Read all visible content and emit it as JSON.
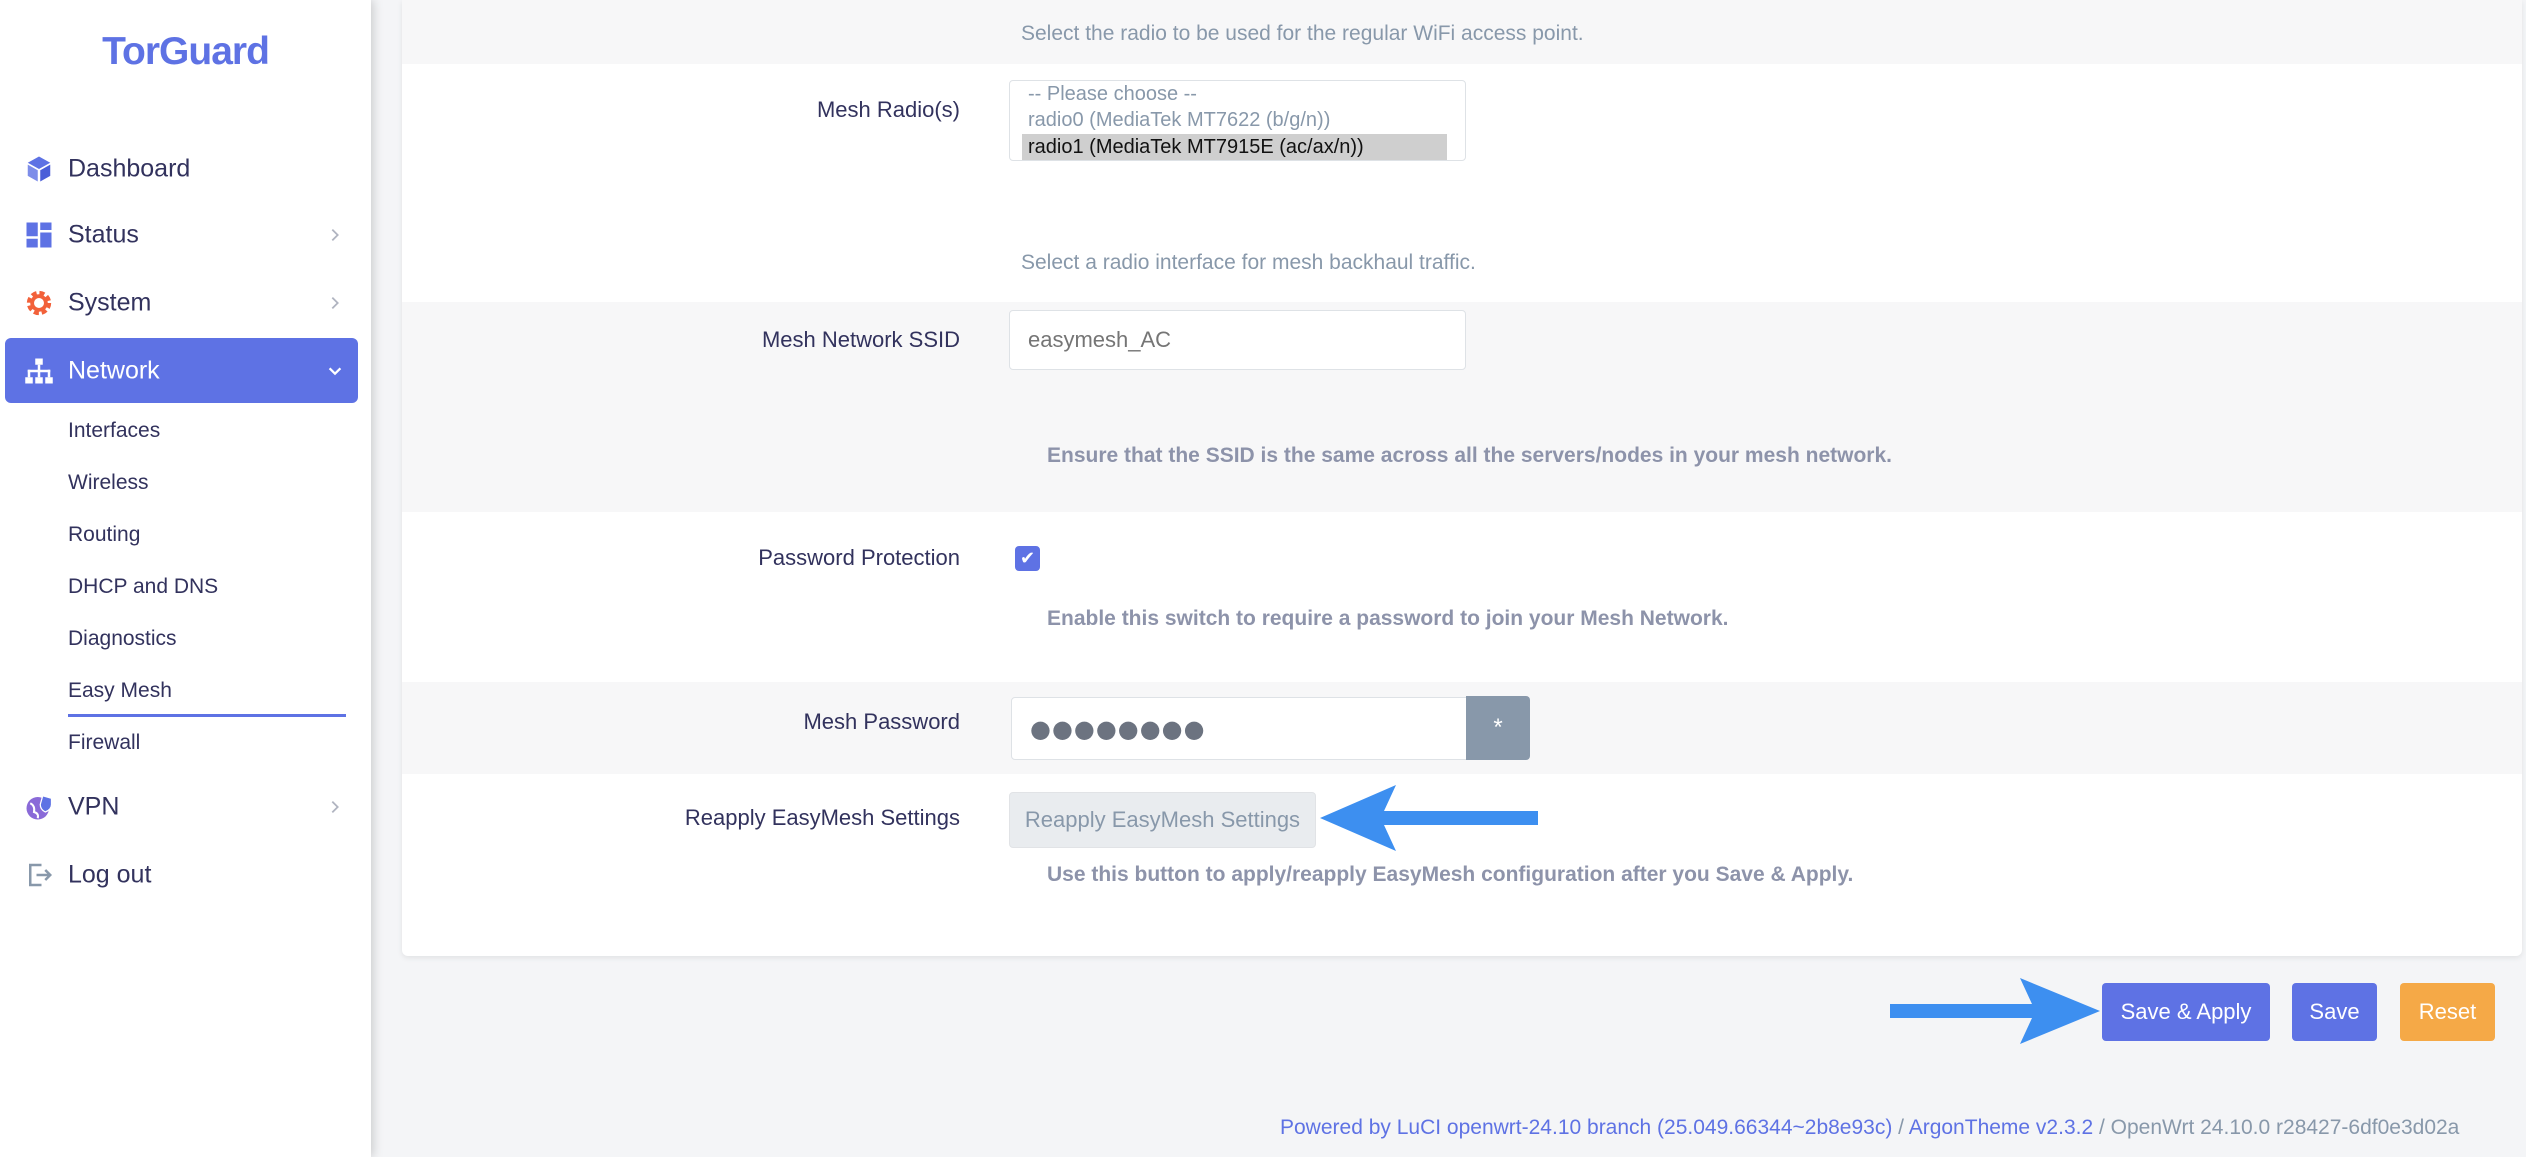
{
  "brand": {
    "logo_text": "TorGuard",
    "accent": "#5e72e4",
    "warning": "#f5a947"
  },
  "sidebar": {
    "items": [
      {
        "label": "Dashboard",
        "icon": "cube-icon"
      },
      {
        "label": "Status",
        "icon": "grid-icon"
      },
      {
        "label": "System",
        "icon": "gear-icon"
      },
      {
        "label": "Network",
        "icon": "network-icon",
        "active": true
      },
      {
        "label": "VPN",
        "icon": "shield-globe-icon"
      },
      {
        "label": "Log out",
        "icon": "logout-icon"
      }
    ],
    "network_sub": [
      "Interfaces",
      "Wireless",
      "Routing",
      "DHCP and DNS",
      "Diagnostics",
      "Easy Mesh",
      "Firewall"
    ],
    "selected_sub": "Easy Mesh"
  },
  "form": {
    "top_help": "Select the radio to be used for the regular WiFi access point.",
    "mesh_radio": {
      "label": "Mesh Radio(s)",
      "options": [
        "-- Please choose --",
        "radio0 (MediaTek MT7622 (b/g/n))",
        "radio1 (MediaTek MT7915E (ac/ax/n))"
      ],
      "selected": "radio1 (MediaTek MT7915E (ac/ax/n))",
      "help": "Select a radio interface for mesh backhaul traffic."
    },
    "mesh_ssid": {
      "label": "Mesh Network SSID",
      "placeholder": "easymesh_AC",
      "help": "Ensure that the SSID is the same across all the servers/nodes in your mesh network."
    },
    "password_protection": {
      "label": "Password Protection",
      "checked": true,
      "check_glyph": "✔",
      "help": "Enable this switch to require a password to join your Mesh Network."
    },
    "mesh_password": {
      "label": "Mesh Password",
      "masked_value": "●●●●●●●●",
      "reveal_label": "*"
    },
    "reapply": {
      "label": "Reapply EasyMesh Settings",
      "button": "Reapply EasyMesh Settings",
      "help": "Use this button to apply/reapply EasyMesh configuration after you Save & Apply."
    }
  },
  "actions": {
    "save_apply": "Save & Apply",
    "save": "Save",
    "reset": "Reset"
  },
  "footer": {
    "luci": "Powered by LuCI openwrt-24.10 branch (25.049.66344~2b8e93c)",
    "sep1": " / ",
    "theme": "ArgonTheme v2.3.2",
    "sep2": " / ",
    "build": "OpenWrt 24.10.0 r28427-6df0e3d02a"
  }
}
